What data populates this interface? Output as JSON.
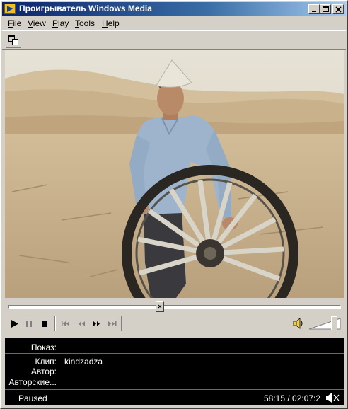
{
  "window": {
    "title": "Проигрыватель Windows Media",
    "controls": [
      "minimize",
      "maximize",
      "close"
    ]
  },
  "menu": {
    "items": [
      {
        "id": "file",
        "label": "File",
        "accel": "F",
        "rest": "ile"
      },
      {
        "id": "view",
        "label": "View",
        "accel": "V",
        "rest": "iew"
      },
      {
        "id": "play",
        "label": "Play",
        "accel": "P",
        "rest": "lay"
      },
      {
        "id": "tools",
        "label": "Tools",
        "accel": "T",
        "rest": "ools"
      },
      {
        "id": "help",
        "label": "Help",
        "accel": "H",
        "rest": "elp"
      }
    ]
  },
  "toolbar": {
    "icon": "resize-window-icon"
  },
  "video": {
    "description_icon": "video-frame",
    "colors": {
      "sky": "#dcd6c4",
      "sand": "#c9b08a",
      "shirt": "#9fb6cf"
    }
  },
  "seek": {
    "position_fraction": 0.455
  },
  "transport": {
    "buttons": [
      "play",
      "pause",
      "stop",
      "skip-back",
      "rewind",
      "fast-forward",
      "skip-forward"
    ]
  },
  "volume": {
    "level_fraction": 0.82,
    "icon": "speaker-icon"
  },
  "info": {
    "show_label": "Показ:",
    "show_value": "",
    "clip_label": "Клип:",
    "clip_value": "kindzadza",
    "author_label": "Автор:",
    "author_value": "",
    "copyright_label": "Авторские...",
    "copyright_value": ""
  },
  "status": {
    "state": "Paused",
    "time": "58:15 / 02:07:2"
  }
}
